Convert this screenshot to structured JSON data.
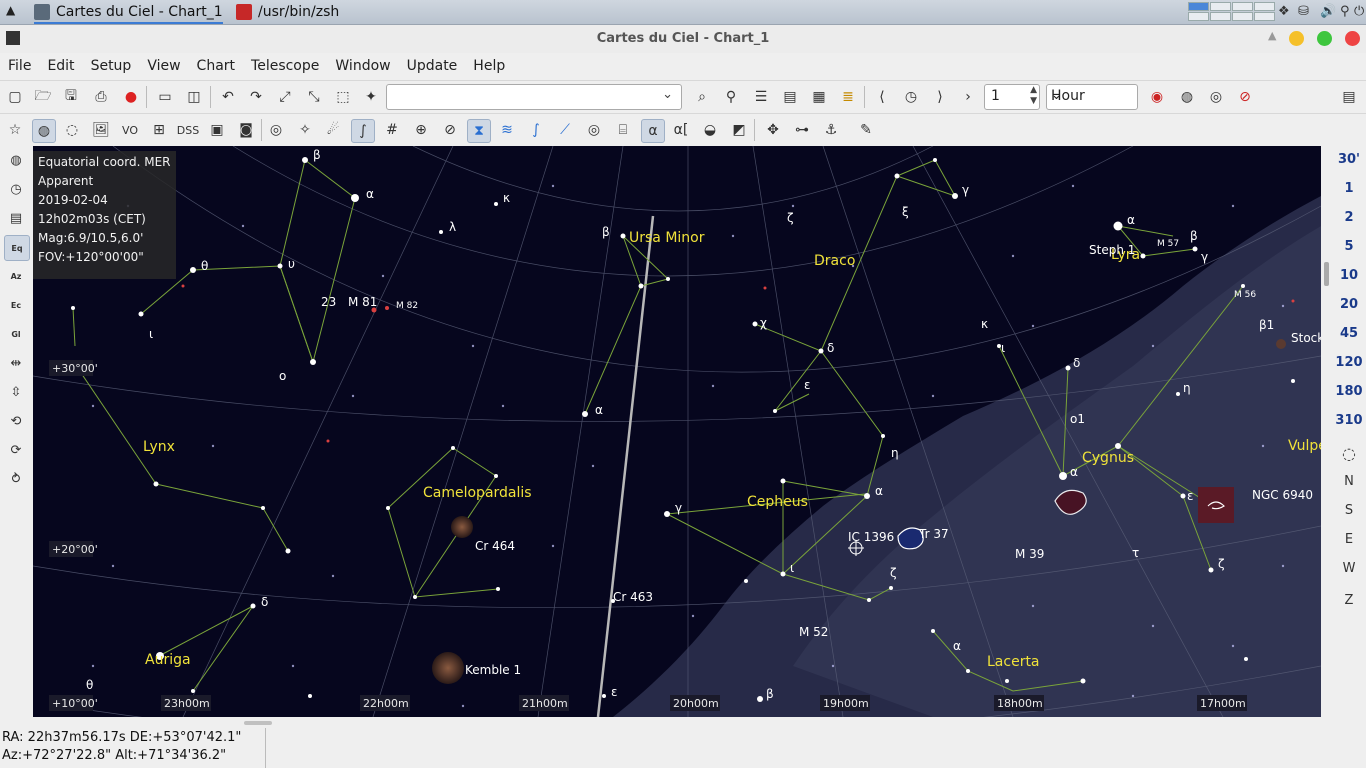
{
  "taskbar": {
    "tasks": [
      {
        "label": "Cartes du Ciel - Chart_1"
      },
      {
        "label": "/usr/bin/zsh"
      }
    ]
  },
  "window": {
    "title": "Cartes du Ciel - Chart_1"
  },
  "menu": [
    "File",
    "Edit",
    "Setup",
    "View",
    "Chart",
    "Telescope",
    "Window",
    "Update",
    "Help"
  ],
  "toolbar": {
    "search_value": "",
    "time_step_value": "1",
    "time_unit": "Hour",
    "vo_label": "VO",
    "dss_label": "DSS",
    "alpha_label": "α",
    "alpha_bracket_label": "α["
  },
  "left_toolbar": {
    "eq_label": "Eq",
    "az_label": "Az",
    "ec_label": "Ec",
    "gl_label": "Gl"
  },
  "fov_buttons": [
    "30'",
    "1",
    "2",
    "5",
    "10",
    "20",
    "45",
    "120",
    "180",
    "310"
  ],
  "right_toolbar": {
    "north": "N",
    "south": "S",
    "east": "E",
    "west": "W",
    "zenith": "Z"
  },
  "info_panel": {
    "lines": [
      "Equatorial coord. MER",
      "Apparent",
      "2019-02-04",
      "12h02m03s (CET)",
      "Mag:6.9/10.5,6.0'",
      "FOV:+120°00'00\""
    ]
  },
  "chart": {
    "constellations": [
      {
        "name": "Ursa Minor"
      },
      {
        "name": "Draco"
      },
      {
        "name": "Lyra"
      },
      {
        "name": "Lynx"
      },
      {
        "name": "Camelopardalis"
      },
      {
        "name": "Cepheus"
      },
      {
        "name": "Cygnus"
      },
      {
        "name": "Vulpe"
      },
      {
        "name": "Auriga"
      },
      {
        "name": "Lacerta"
      }
    ],
    "objects": [
      {
        "name": "M 81"
      },
      {
        "name": "M 82"
      },
      {
        "name": "Cr 464"
      },
      {
        "name": "Cr 463"
      },
      {
        "name": "IC 1396"
      },
      {
        "name": "Tr 37"
      },
      {
        "name": "M 39"
      },
      {
        "name": "M 52"
      },
      {
        "name": "Kemble 1"
      },
      {
        "name": "NGC 6940"
      },
      {
        "name": "Steph 1"
      },
      {
        "name": "M 57"
      },
      {
        "name": "M 56"
      },
      {
        "name": "Stock"
      },
      {
        "name": "23"
      },
      {
        "name": "o1"
      },
      {
        "name": "β1"
      }
    ],
    "greek": [
      {
        "name": "β"
      },
      {
        "name": "κ"
      },
      {
        "name": "λ"
      },
      {
        "name": "α"
      },
      {
        "name": "θ"
      },
      {
        "name": "υ"
      },
      {
        "name": "ι"
      },
      {
        "name": "ο"
      },
      {
        "name": "β"
      },
      {
        "name": "ξ"
      },
      {
        "name": "γ"
      },
      {
        "name": "ζ"
      },
      {
        "name": "χ"
      },
      {
        "name": "δ"
      },
      {
        "name": "ε"
      },
      {
        "name": "α"
      },
      {
        "name": "α"
      },
      {
        "name": "η"
      },
      {
        "name": "γ"
      },
      {
        "name": "α"
      },
      {
        "name": "ι"
      },
      {
        "name": "ζ"
      },
      {
        "name": "κ"
      },
      {
        "name": "δ"
      },
      {
        "name": "ι"
      },
      {
        "name": "α"
      },
      {
        "name": "β"
      },
      {
        "name": "γ"
      },
      {
        "name": "η"
      },
      {
        "name": "ε"
      },
      {
        "name": "τ"
      },
      {
        "name": "ζ"
      },
      {
        "name": "α"
      },
      {
        "name": "δ"
      },
      {
        "name": "θ"
      },
      {
        "name": "ε"
      },
      {
        "name": "β"
      }
    ],
    "dec_labels": [
      "+30°00'",
      "+20°00'",
      "+10°00'"
    ],
    "ra_labels": [
      "23h00m",
      "22h00m",
      "21h00m",
      "20h00m",
      "19h00m",
      "18h00m",
      "17h00m"
    ]
  },
  "status": {
    "line1": "RA: 22h37m56.17s DE:+53°07'42.1\"",
    "line2": "Az:+72°27'22.8\" Alt:+71°34'36.2\""
  }
}
